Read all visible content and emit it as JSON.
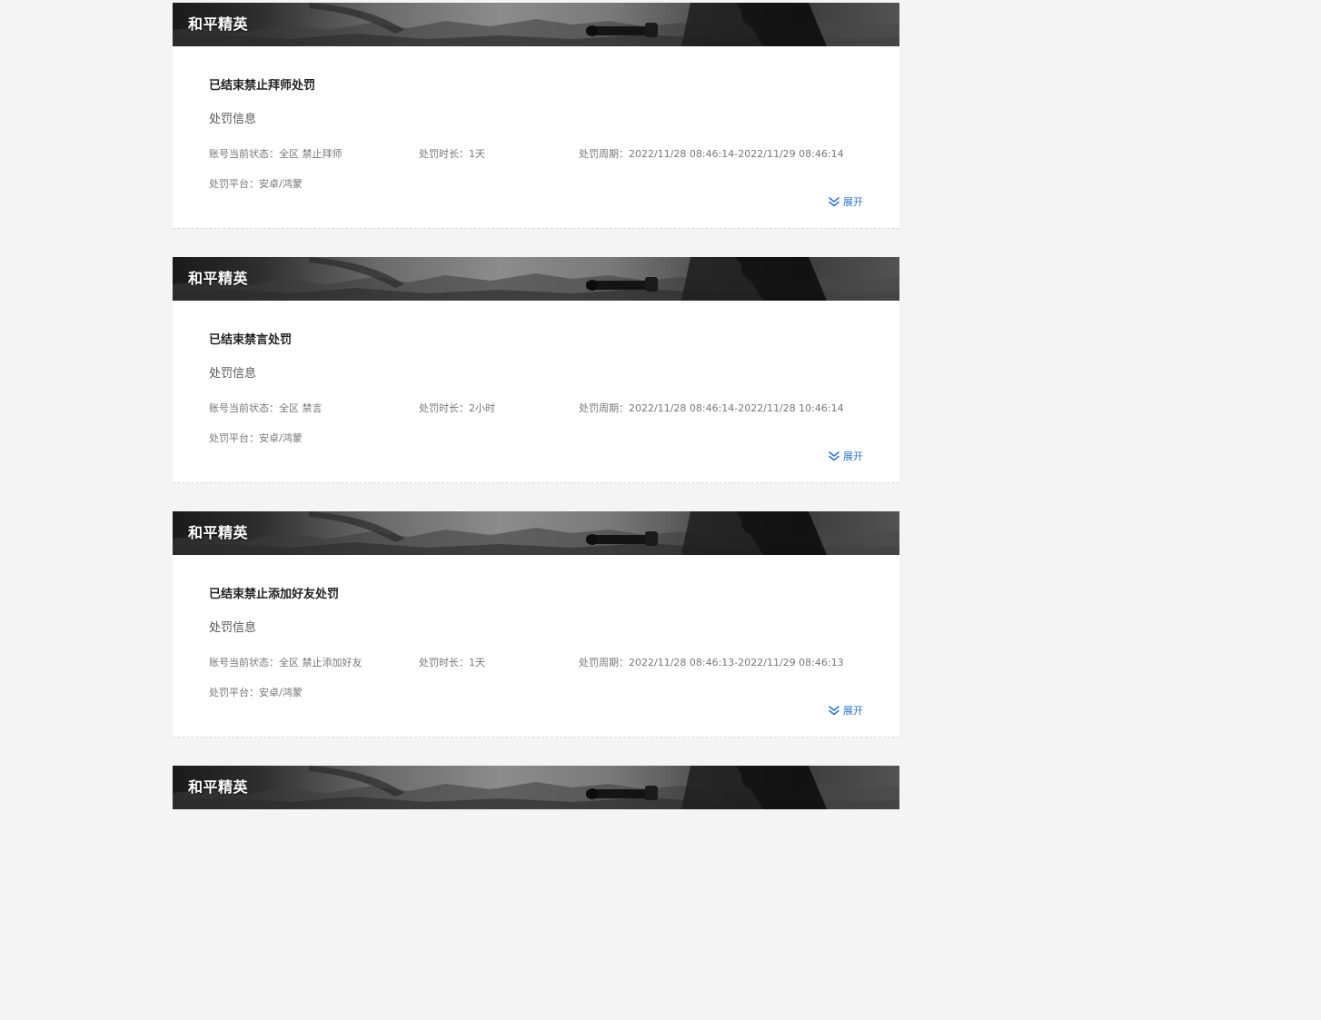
{
  "records": [
    {
      "game": "和平精英",
      "title": "已结束禁止拜师处罚",
      "section_label": "处罚信息",
      "status": "账号当前状态：全区 禁止拜师",
      "duration": "处罚时长：1天",
      "period": "处罚周期：2022/11/28 08:46:14-2022/11/29 08:46:14",
      "platform": "处罚平台：安卓/鸿蒙",
      "expand_label": "展开"
    },
    {
      "game": "和平精英",
      "title": "已结束禁言处罚",
      "section_label": "处罚信息",
      "status": "账号当前状态：全区 禁言",
      "duration": "处罚时长：2小时",
      "period": "处罚周期：2022/11/28 08:46:14-2022/11/28 10:46:14",
      "platform": "处罚平台：安卓/鸿蒙",
      "expand_label": "展开"
    },
    {
      "game": "和平精英",
      "title": "已结束禁止添加好友处罚",
      "section_label": "处罚信息",
      "status": "账号当前状态：全区 禁止添加好友",
      "duration": "处罚时长：1天",
      "period": "处罚周期：2022/11/28 08:46:13-2022/11/29 08:46:13",
      "platform": "处罚平台：安卓/鸿蒙",
      "expand_label": "展开"
    },
    {
      "game": "和平精英"
    }
  ],
  "icons": {
    "expand": "double-chevron-down-icon",
    "banner": "game-banner-image"
  },
  "colors": {
    "accent": "#2d74d6",
    "background": "#f4f4f4"
  }
}
